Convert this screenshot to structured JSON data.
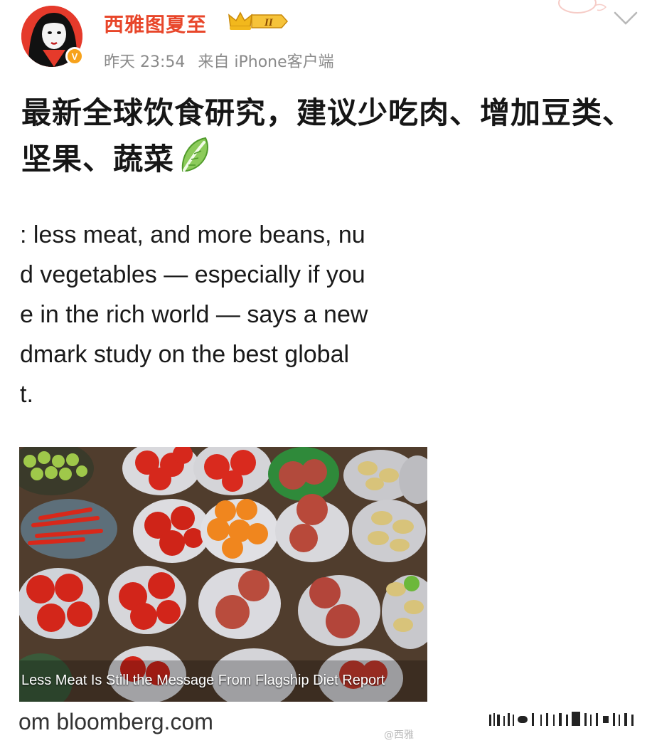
{
  "user": {
    "name": "西雅图夏至",
    "verified_badge": "V",
    "level_badge": "II",
    "time": "昨天 23:54",
    "source": "来自 iPhone客户端"
  },
  "post": {
    "title": "最新全球饮食研究，建议少吃肉、增加豆类、坚果、蔬菜",
    "emoji": "leafy-green-icon"
  },
  "quote_lines": [
    ": less meat, and more beans, nu",
    "d vegetables — especially if you",
    "e in the rich world — says a new",
    "dmark study on the best global",
    "t."
  ],
  "article": {
    "caption": "Less Meat Is Still the Message From Flagship Diet Report",
    "source_link": "om bloomberg.com"
  },
  "watermark": "@西雅",
  "colors": {
    "username": "#e8462a",
    "meta": "#8a8a8a",
    "avatar_bg": "#e53a2b",
    "badge": "#f7a21b"
  }
}
